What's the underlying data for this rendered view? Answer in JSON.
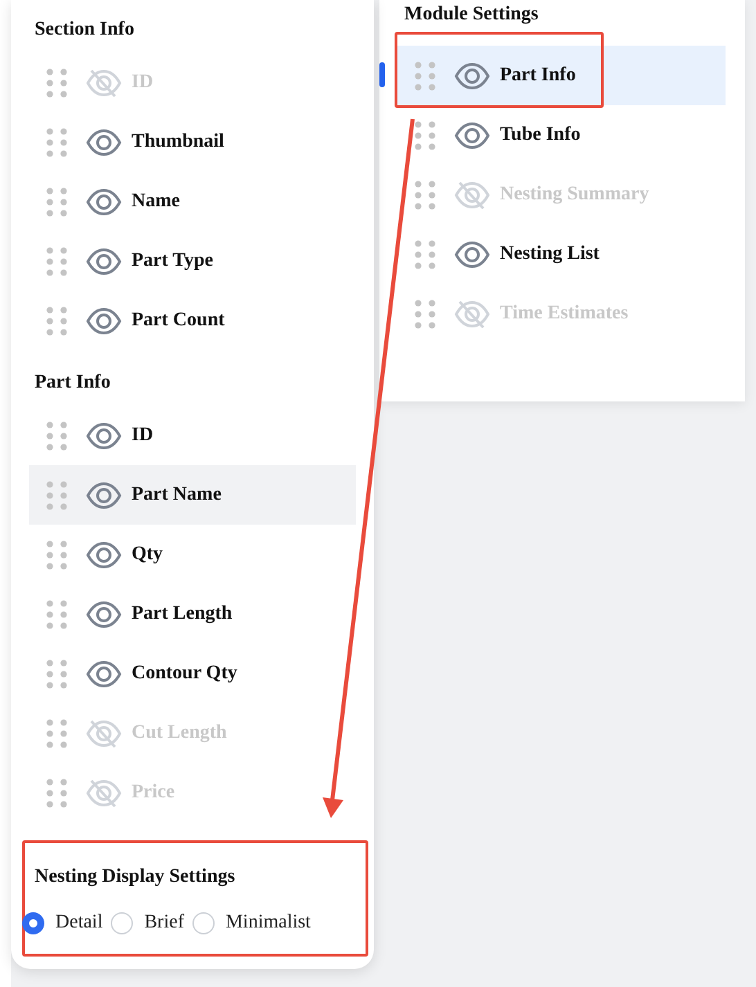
{
  "field_panel": {
    "sections": [
      {
        "title": "Section Info",
        "items": [
          {
            "label": "ID",
            "visible": false,
            "highlighted": false
          },
          {
            "label": "Thumbnail",
            "visible": true,
            "highlighted": false
          },
          {
            "label": "Name",
            "visible": true,
            "highlighted": false
          },
          {
            "label": "Part Type",
            "visible": true,
            "highlighted": false
          },
          {
            "label": "Part Count",
            "visible": true,
            "highlighted": false
          }
        ]
      },
      {
        "title": "Part Info",
        "items": [
          {
            "label": "ID",
            "visible": true,
            "highlighted": false
          },
          {
            "label": "Part Name",
            "visible": true,
            "highlighted": true
          },
          {
            "label": "Qty",
            "visible": true,
            "highlighted": false
          },
          {
            "label": "Part Length",
            "visible": true,
            "highlighted": false
          },
          {
            "label": "Contour Qty",
            "visible": true,
            "highlighted": false
          },
          {
            "label": "Cut Length",
            "visible": false,
            "highlighted": false
          },
          {
            "label": "Price",
            "visible": false,
            "highlighted": false
          }
        ]
      }
    ],
    "display_settings": {
      "title": "Nesting Display Settings",
      "annotated": true,
      "options": [
        {
          "label": "Detail",
          "selected": true
        },
        {
          "label": "Brief",
          "selected": false
        },
        {
          "label": "Minimalist",
          "selected": false
        }
      ]
    }
  },
  "module_settings": {
    "title": "Module Settings",
    "items": [
      {
        "label": "Part Info",
        "visible": true,
        "selected": true,
        "annotated": true
      },
      {
        "label": "Tube Info",
        "visible": true,
        "selected": false,
        "annotated": false
      },
      {
        "label": "Nesting Summary",
        "visible": false,
        "selected": false,
        "annotated": false
      },
      {
        "label": "Nesting List",
        "visible": true,
        "selected": false,
        "annotated": false
      },
      {
        "label": "Time Estimates",
        "visible": false,
        "selected": false,
        "annotated": false
      }
    ]
  }
}
